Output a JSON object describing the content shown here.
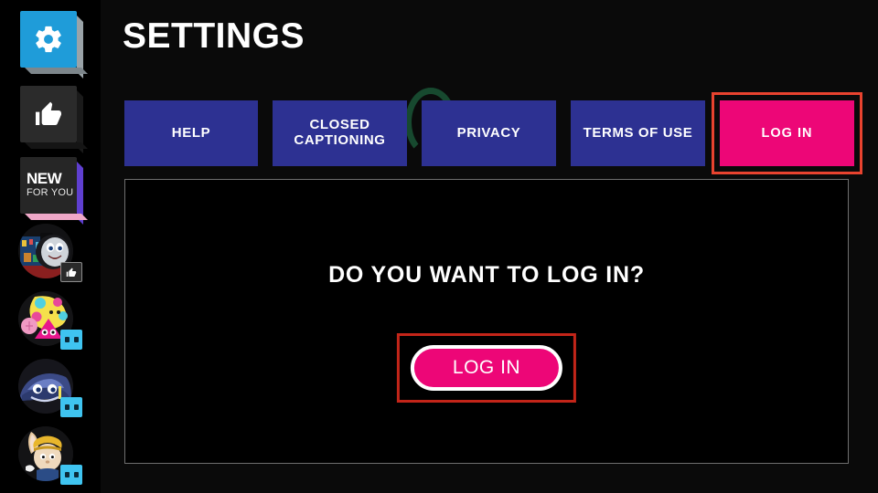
{
  "header": {
    "title": "SETTINGS"
  },
  "sidebar": {
    "tiles": [
      {
        "label": "",
        "icon": "gear-icon",
        "name": "settings",
        "color": "#1f9cd9"
      },
      {
        "label": "",
        "icon": "thumbs-up-icon",
        "name": "likes",
        "color": "#2b2b2b"
      },
      {
        "label_top": "NEW",
        "label_bottom": "FOR YOU",
        "icon": "new-for-you",
        "name": "new-for-you",
        "color": "#262626"
      }
    ],
    "avatars": [
      {
        "name": "thomas-avatar",
        "badge": "thumbs-up-badge",
        "badge_style": "dark"
      },
      {
        "name": "shapes-avatar",
        "badge": "eyes-badge",
        "badge_style": "cyan"
      },
      {
        "name": "car-avatar",
        "badge": "eyes-badge",
        "badge_style": "cyan"
      },
      {
        "name": "bunny-avatar",
        "badge": "eyes-badge",
        "badge_style": "cyan"
      }
    ]
  },
  "tabs": [
    {
      "label": "HELP",
      "selected": false,
      "color": "#2d3192"
    },
    {
      "label": "CLOSED CAPTIONING",
      "selected": false,
      "color": "#2d3192"
    },
    {
      "label": "PRIVACY",
      "selected": false,
      "color": "#2d3192"
    },
    {
      "label": "TERMS OF USE",
      "selected": false,
      "color": "#2d3192"
    },
    {
      "label": "LOG IN",
      "selected": true,
      "color": "#ed0677"
    }
  ],
  "panel": {
    "question": "DO YOU WANT TO LOG IN?",
    "login_button_label": "LOG IN"
  },
  "colors": {
    "background": "#000000",
    "tab_blue": "#2d3192",
    "accent_pink": "#ed0677",
    "focus_red": "#c32519",
    "tile_blue": "#1f9cd9",
    "panel_border": "#6f6f6f"
  }
}
